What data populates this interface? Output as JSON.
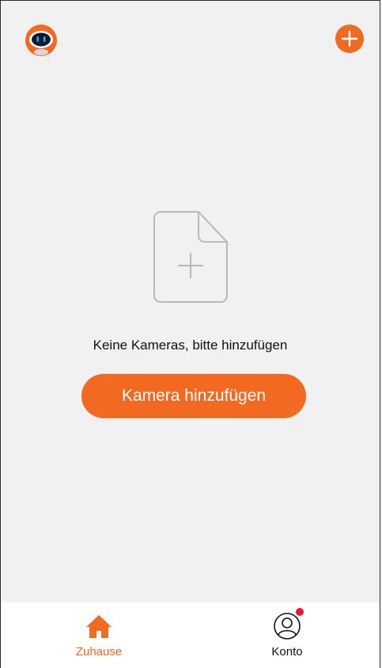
{
  "header": {
    "avatar_icon": "robot-avatar-icon",
    "add_icon": "plus-icon"
  },
  "empty_state": {
    "icon": "add-document-icon",
    "message": "Keine Kameras, bitte hinzufügen",
    "button_label": "Kamera hinzufügen"
  },
  "tabbar": {
    "items": [
      {
        "label": "Zuhause",
        "icon": "home-icon",
        "active": true
      },
      {
        "label": "Konto",
        "icon": "user-icon",
        "active": false,
        "notification_dot": true
      }
    ]
  },
  "colors": {
    "accent": "#f26a21",
    "background": "#f1f1f1",
    "notification": "#f0182b"
  }
}
